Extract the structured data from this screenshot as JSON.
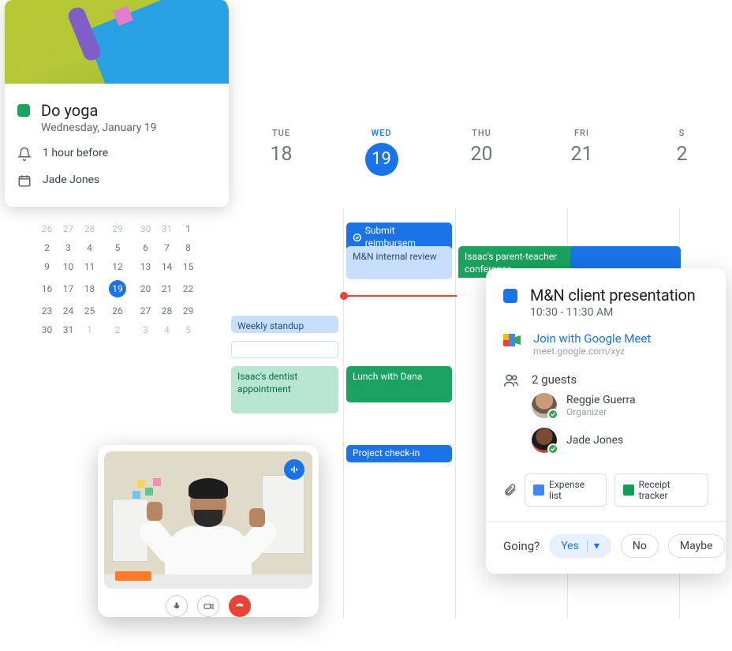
{
  "event_card": {
    "title": "Do yoga",
    "date": "Wednesday, January 19",
    "reminder": "1 hour before",
    "organizer": "Jade Jones",
    "color": "#1aa260"
  },
  "mini_calendar": {
    "grid": [
      [
        "26",
        "27",
        "28",
        "29",
        "30",
        "31",
        "1"
      ],
      [
        "2",
        "3",
        "4",
        "5",
        "6",
        "7",
        "8"
      ],
      [
        "9",
        "10",
        "11",
        "12",
        "13",
        "14",
        "15"
      ],
      [
        "16",
        "17",
        "18",
        "19",
        "20",
        "21",
        "22"
      ],
      [
        "23",
        "24",
        "25",
        "26",
        "27",
        "28",
        "29"
      ],
      [
        "30",
        "31",
        "1",
        "2",
        "3",
        "4",
        "5"
      ]
    ],
    "selected": "19"
  },
  "week_header": {
    "days": [
      {
        "label": "TUE",
        "num": "18"
      },
      {
        "label": "WED",
        "num": "19",
        "current": true
      },
      {
        "label": "THU",
        "num": "20"
      },
      {
        "label": "FRI",
        "num": "21"
      },
      {
        "label": "S",
        "num": "2"
      }
    ]
  },
  "events": {
    "submit_reimbursement": "Submit reimbursem",
    "internal_review": "M&N internal review",
    "parent_teacher": "Isaac's parent-teacher conference",
    "weekly_standup": "Weekly standup",
    "dentist": "Isaac's dentist appointment",
    "lunch_dana": "Lunch with Dana",
    "project_checkin": "Project check-in"
  },
  "detail": {
    "title": "M&N client presentation",
    "time": "10:30 - 11:30 AM",
    "meet_label": "Join with Google Meet",
    "meet_url": "meet.google.com/xyz",
    "guests_count": "2 guests",
    "guests": [
      {
        "name": "Reggie Guerra",
        "role": "Organizer"
      },
      {
        "name": "Jade Jones",
        "role": ""
      }
    ],
    "attachments": [
      {
        "label": "Expense list",
        "kind": "doc"
      },
      {
        "label": "Receipt tracker",
        "kind": "sheet"
      }
    ],
    "going_label": "Going?",
    "going_options": {
      "yes": "Yes",
      "no": "No",
      "maybe": "Maybe"
    }
  }
}
